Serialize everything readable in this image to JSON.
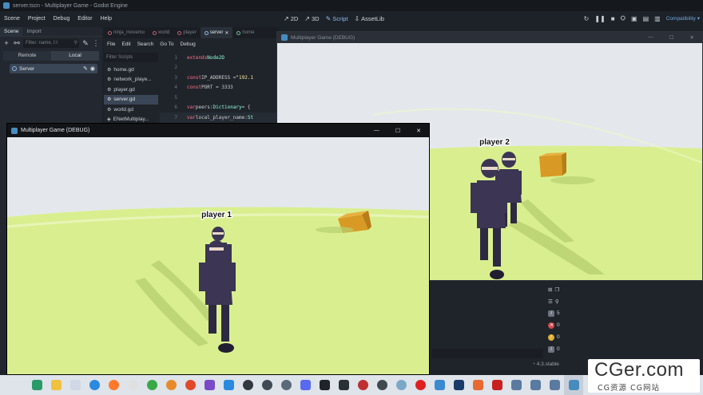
{
  "editor": {
    "window_title": "server.tscn - Multiplayer Game - Godot Engine",
    "menus": [
      "Scene",
      "Project",
      "Debug",
      "Editor",
      "Help"
    ],
    "workspaces": [
      {
        "label": "2D",
        "glyph": "↗"
      },
      {
        "label": "3D",
        "glyph": "↗"
      },
      {
        "label": "Script",
        "glyph": "✎"
      },
      {
        "label": "AssetLib",
        "glyph": "⇩"
      }
    ],
    "renderer": "Compatibility ▾",
    "version": "4.3.stable"
  },
  "scene_dock": {
    "tabs": [
      "Scene",
      "Import"
    ],
    "filter_placeholder": "Filter: name, t:t",
    "mode_tabs": [
      "Remote",
      "Local"
    ],
    "root_node": "Server"
  },
  "script_editor": {
    "tabs": [
      "ninja_movemo",
      "world",
      "player",
      "server",
      "home"
    ],
    "menu": [
      "File",
      "Edit",
      "Search",
      "Go To",
      "Debug"
    ],
    "filter_placeholder": "Filter Scripts",
    "scripts": [
      "home.gd",
      "network_playe...",
      "player.gd",
      "server.gd",
      "world.gd",
      "ENetMultiplay..."
    ],
    "code": [
      {
        "n": "1",
        "parts": [
          [
            "kw",
            "extends "
          ],
          [
            "cls",
            "Node2D"
          ]
        ]
      },
      {
        "n": "2",
        "parts": []
      },
      {
        "n": "3",
        "parts": [
          [
            "kw",
            "const "
          ],
          [
            "plain",
            "IP_ADDRESS = "
          ],
          [
            "str",
            "\"192.1"
          ]
        ]
      },
      {
        "n": "4",
        "parts": [
          [
            "kw",
            "const "
          ],
          [
            "plain",
            "PORT = 3333"
          ]
        ]
      },
      {
        "n": "5",
        "parts": []
      },
      {
        "n": "6",
        "parts": [
          [
            "kw",
            "var "
          ],
          [
            "plain",
            "peers: "
          ],
          [
            "cls",
            "Dictionary"
          ],
          [
            "plain",
            " = {"
          ]
        ]
      },
      {
        "n": "7",
        "parts": [
          [
            "kw",
            "var "
          ],
          [
            "plain",
            "local_player_name: "
          ],
          [
            "cls",
            "St"
          ]
        ]
      }
    ]
  },
  "debugger": {
    "counts": [
      "5",
      "0",
      "0",
      "0"
    ]
  },
  "game_window_front": {
    "title": "Multiplayer Game (DEBUG)",
    "player_label": "player 1"
  },
  "game_window_back": {
    "title": "Multiplayer Game (DEBUG)",
    "player_label": "player 2"
  },
  "watermark": {
    "big": "CGer.com",
    "small": "CG资源 CG网站"
  },
  "colors": {
    "sky": "#e4e8ec",
    "ground": "#d9ef8f",
    "ninja": "#3c3554",
    "crate": "#d89a25",
    "accent": "#478cbf"
  }
}
